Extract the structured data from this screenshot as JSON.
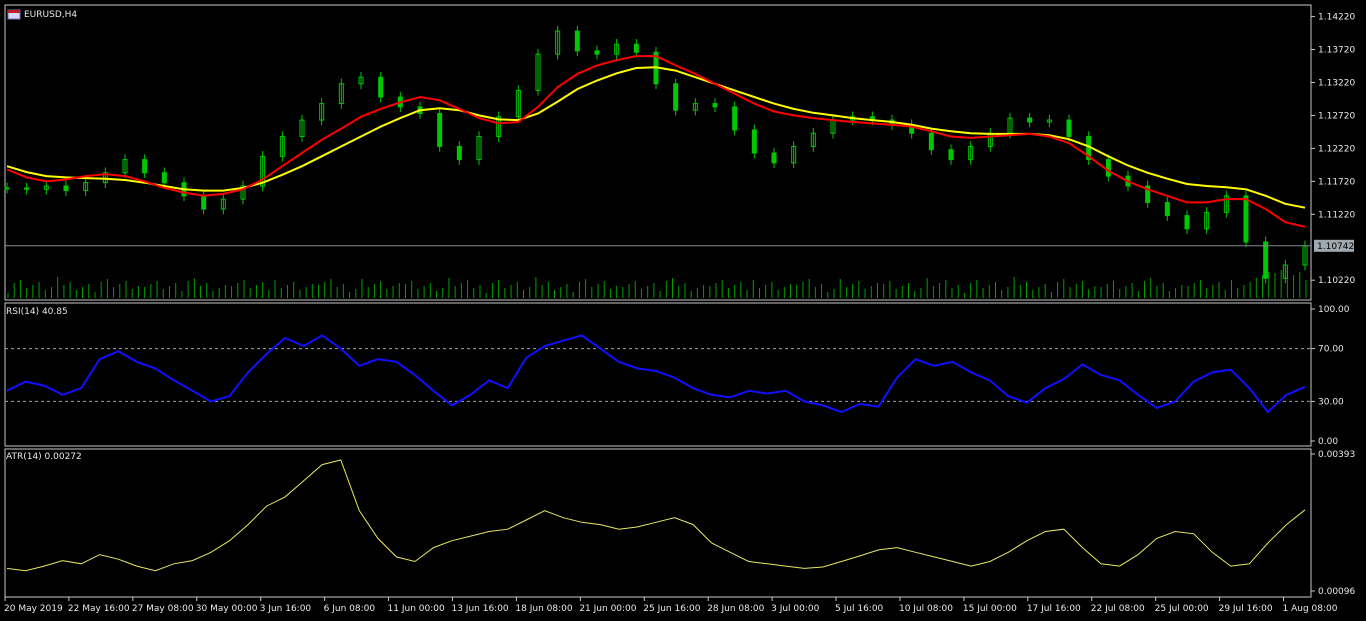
{
  "title": "EURUSD,H4",
  "colors": {
    "background": "#000000",
    "frame": "#c8c8c8",
    "candle": "#00c800",
    "volume": "#00a000",
    "ma_fast": "#ff0000",
    "ma_slow": "#ffff00",
    "rsi": "#1010ff",
    "atr": "#e8e860",
    "grid_dash": "#a0a0a0",
    "price_tag_bg": "#a0a8b0"
  },
  "icons": {
    "window": "chart-window-icon"
  },
  "chart_data": [
    {
      "type": "line",
      "name": "price",
      "title": "EURUSD,H4",
      "ylim": [
        1.0995,
        1.1432
      ],
      "y_ticks": [
        "1.14220",
        "1.13720",
        "1.13220",
        "1.12720",
        "1.12220",
        "1.11720",
        "1.11220",
        "1.10220"
      ],
      "current_price": "1.10742",
      "x_ticks": [
        "20 May 2019",
        "22 May 16:00",
        "27 May 08:00",
        "30 May 00:00",
        "3 Jun 16:00",
        "6 Jun 08:00",
        "11 Jun 00:00",
        "13 Jun 16:00",
        "18 Jun 08:00",
        "21 Jun 00:00",
        "25 Jun 16:00",
        "28 Jun 08:00",
        "3 Jul 00:00",
        "5 Jul 16:00",
        "10 Jul 08:00",
        "15 Jul 00:00",
        "17 Jul 16:00",
        "22 Jul 08:00",
        "25 Jul 00:00",
        "29 Jul 16:00",
        "1 Aug 08:00"
      ],
      "close": [
        1.1162,
        1.116,
        1.1165,
        1.1158,
        1.117,
        1.1185,
        1.1205,
        1.1185,
        1.117,
        1.115,
        1.113,
        1.1145,
        1.1165,
        1.121,
        1.124,
        1.1265,
        1.129,
        1.132,
        1.133,
        1.13,
        1.1285,
        1.1275,
        1.1225,
        1.1205,
        1.124,
        1.127,
        1.131,
        1.1365,
        1.14,
        1.137,
        1.1365,
        1.138,
        1.1368,
        1.132,
        1.128,
        1.129,
        1.1285,
        1.125,
        1.1215,
        1.12,
        1.1225,
        1.1245,
        1.1265,
        1.127,
        1.1265,
        1.1258,
        1.1245,
        1.122,
        1.1205,
        1.1225,
        1.1245,
        1.1268,
        1.1262,
        1.1265,
        1.124,
        1.1205,
        1.118,
        1.1165,
        1.114,
        1.112,
        1.11,
        1.1125,
        1.115,
        1.108,
        1.1025,
        1.1045,
        1.1074
      ],
      "ma_fast": [
        1.119,
        1.1178,
        1.1172,
        1.1175,
        1.118,
        1.1183,
        1.118,
        1.1172,
        1.1162,
        1.1155,
        1.115,
        1.1153,
        1.116,
        1.1175,
        1.1195,
        1.1215,
        1.1235,
        1.1252,
        1.127,
        1.1282,
        1.1292,
        1.13,
        1.1295,
        1.1282,
        1.1268,
        1.126,
        1.1262,
        1.1285,
        1.1315,
        1.1335,
        1.1348,
        1.1356,
        1.1362,
        1.1362,
        1.1348,
        1.1335,
        1.132,
        1.1305,
        1.129,
        1.1278,
        1.1272,
        1.1268,
        1.1265,
        1.1262,
        1.126,
        1.1258,
        1.1255,
        1.1248,
        1.124,
        1.1238,
        1.124,
        1.1242,
        1.1244,
        1.124,
        1.123,
        1.121,
        1.1188,
        1.1172,
        1.116,
        1.115,
        1.114,
        1.114,
        1.1145,
        1.1145,
        1.113,
        1.111,
        1.1103
      ],
      "ma_slow": [
        1.1195,
        1.1186,
        1.118,
        1.1178,
        1.1177,
        1.1176,
        1.1174,
        1.117,
        1.1165,
        1.116,
        1.1158,
        1.1158,
        1.1162,
        1.117,
        1.1182,
        1.1195,
        1.121,
        1.1225,
        1.124,
        1.1255,
        1.1268,
        1.128,
        1.1283,
        1.128,
        1.1272,
        1.1266,
        1.1265,
        1.1275,
        1.1293,
        1.1312,
        1.1325,
        1.1336,
        1.1344,
        1.1345,
        1.134,
        1.133,
        1.132,
        1.131,
        1.13,
        1.129,
        1.1282,
        1.1276,
        1.1272,
        1.1268,
        1.1265,
        1.1262,
        1.1258,
        1.1252,
        1.1248,
        1.1245,
        1.1244,
        1.1244,
        1.1244,
        1.1242,
        1.1236,
        1.1225,
        1.121,
        1.1196,
        1.1185,
        1.1176,
        1.1168,
        1.1165,
        1.1163,
        1.116,
        1.115,
        1.1138,
        1.1132
      ]
    },
    {
      "type": "line",
      "name": "rsi",
      "title": "RSI(14) 40.85",
      "ylim": [
        0,
        100
      ],
      "y_ticks": [
        "100.00",
        "70.00",
        "30.00",
        "0.00"
      ],
      "levels": [
        70,
        30
      ],
      "values": [
        38,
        45,
        42,
        35,
        40,
        62,
        68,
        60,
        55,
        46,
        38,
        30,
        34,
        52,
        66,
        78,
        72,
        80,
        70,
        57,
        62,
        60,
        50,
        38,
        27,
        35,
        46,
        40,
        63,
        72,
        76,
        80,
        70,
        60,
        55,
        53,
        48,
        40,
        35,
        33,
        38,
        36,
        38,
        30,
        27,
        22,
        28,
        26,
        48,
        62,
        57,
        60,
        52,
        46,
        34,
        29,
        40,
        47,
        58,
        50,
        46,
        35,
        25,
        30,
        45,
        52,
        54,
        40,
        22,
        35,
        41
      ]
    },
    {
      "type": "line",
      "name": "atr",
      "title": "ATR(14) 0.00272",
      "ylim": [
        0.00096,
        0.00393
      ],
      "y_ticks": [
        "0.00393",
        "0.00096"
      ],
      "values": [
        0.00145,
        0.0014,
        0.0015,
        0.00162,
        0.00155,
        0.00175,
        0.00165,
        0.0015,
        0.0014,
        0.00155,
        0.00162,
        0.0018,
        0.00205,
        0.0024,
        0.0028,
        0.003,
        0.00335,
        0.0037,
        0.0038,
        0.0027,
        0.0021,
        0.0017,
        0.0016,
        0.0019,
        0.00205,
        0.00215,
        0.00225,
        0.0023,
        0.0025,
        0.0027,
        0.00255,
        0.00245,
        0.0024,
        0.0023,
        0.00235,
        0.00245,
        0.00255,
        0.0024,
        0.002,
        0.0018,
        0.0016,
        0.00155,
        0.0015,
        0.00145,
        0.00148,
        0.0016,
        0.00172,
        0.00185,
        0.0019,
        0.0018,
        0.0017,
        0.0016,
        0.0015,
        0.0016,
        0.0018,
        0.00205,
        0.00225,
        0.0023,
        0.0019,
        0.00155,
        0.0015,
        0.00175,
        0.0021,
        0.00225,
        0.0022,
        0.0018,
        0.0015,
        0.00155,
        0.002,
        0.0024,
        0.00272
      ]
    }
  ]
}
